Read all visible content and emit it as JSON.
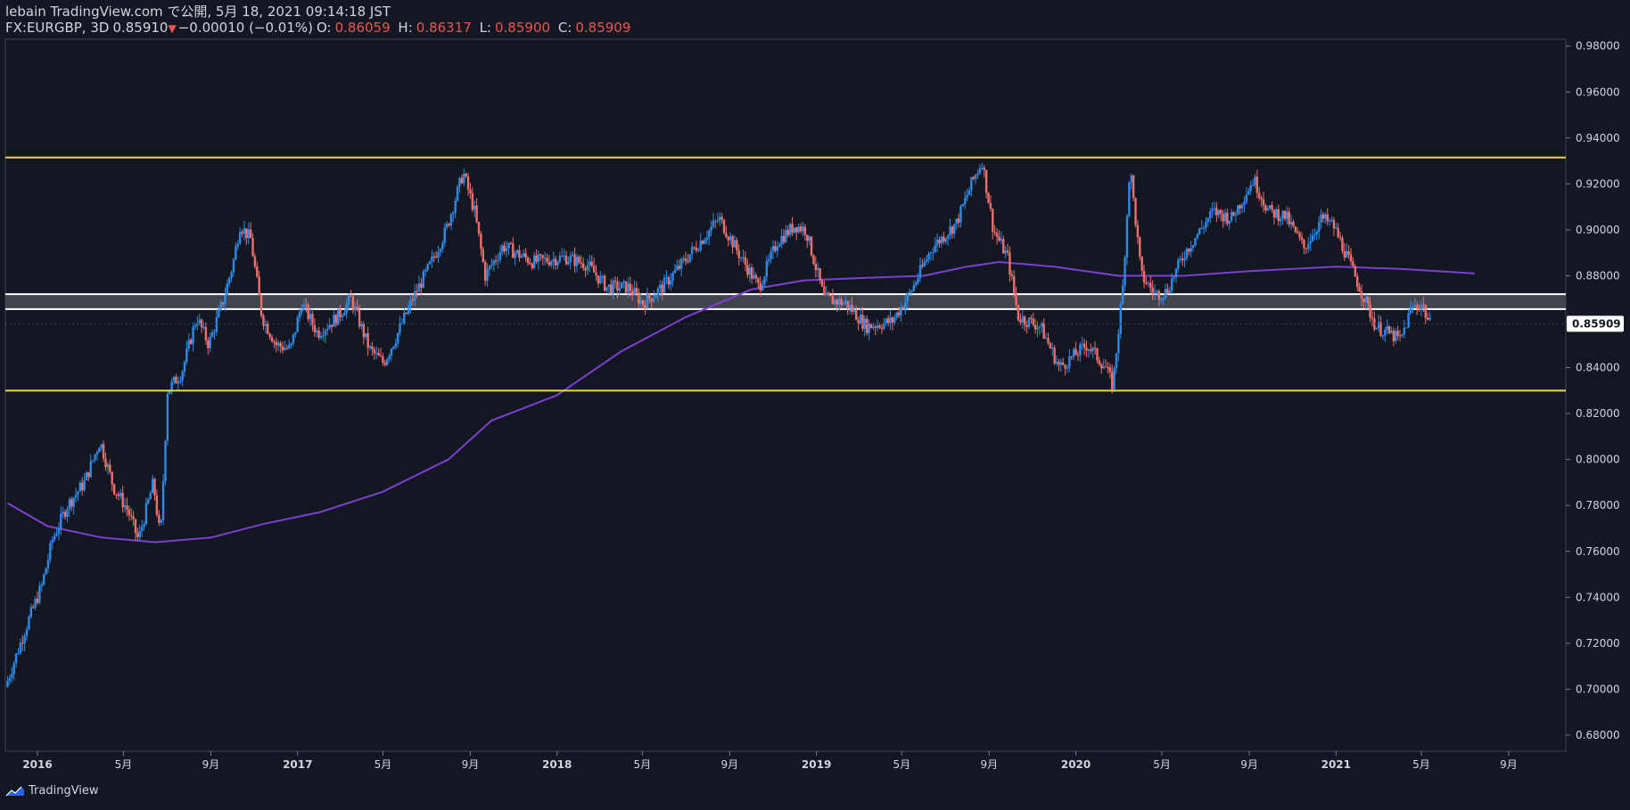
{
  "header": {
    "publisher_line": "lebain TradingView.com で公開, 5月 18, 2021 09:14:18 JST",
    "symbol": "FX:EURGBP, 3D",
    "last": "0.85910",
    "arrow": "▼",
    "change": "−0.00010 (−0.01%)",
    "open_label": "O:",
    "open": "0.86059",
    "high_label": "H:",
    "high": "0.86317",
    "low_label": "L:",
    "low": "0.85900",
    "close_label": "C:",
    "close": "0.85909"
  },
  "footer": {
    "brand": "TradingView"
  },
  "colors": {
    "background": "#131722",
    "up": "#2f8ae6",
    "down": "#ef6f6c",
    "ma": "#7e3fd1",
    "support_resistance": "#f0d44c",
    "zone_fill": "#4a4c54",
    "zone_line": "#ffffff",
    "price_badge": "#ffffff"
  },
  "chart_data": {
    "type": "candlestick",
    "symbol": "FX:EURGBP",
    "timeframe": "3D",
    "y_ticks": [
      "0.98000",
      "0.96000",
      "0.94000",
      "0.92000",
      "0.90000",
      "0.88000",
      "0.86000",
      "0.84000",
      "0.82000",
      "0.80000",
      "0.78000",
      "0.76000",
      "0.74000",
      "0.72000",
      "0.70000",
      "0.68000"
    ],
    "y_range": [
      0.673,
      0.983
    ],
    "current_price_label": "0.85909",
    "current_price": 0.85909,
    "x_ticks": [
      {
        "label": "2016",
        "date": "2016-01"
      },
      {
        "label": "5月",
        "date": "2016-05"
      },
      {
        "label": "9月",
        "date": "2016-09"
      },
      {
        "label": "2017",
        "date": "2017-01"
      },
      {
        "label": "5月",
        "date": "2017-05"
      },
      {
        "label": "9月",
        "date": "2017-09"
      },
      {
        "label": "2018",
        "date": "2018-01"
      },
      {
        "label": "5月",
        "date": "2018-05"
      },
      {
        "label": "9月",
        "date": "2018-09"
      },
      {
        "label": "2019",
        "date": "2019-01"
      },
      {
        "label": "5月",
        "date": "2019-05"
      },
      {
        "label": "9月",
        "date": "2019-09"
      },
      {
        "label": "2020",
        "date": "2020-01"
      },
      {
        "label": "5月",
        "date": "2020-05"
      },
      {
        "label": "9月",
        "date": "2020-09"
      },
      {
        "label": "2021",
        "date": "2021-01"
      },
      {
        "label": "5月",
        "date": "2021-05"
      },
      {
        "label": "9月",
        "date": "2021-09"
      }
    ],
    "horizontal_levels": [
      {
        "name": "resistance",
        "value": 0.9315
      },
      {
        "name": "support",
        "value": 0.83
      }
    ],
    "zone": {
      "top": 0.872,
      "bottom": 0.8655
    },
    "price_path": [
      [
        "2015-11-20",
        0.701
      ],
      [
        "2015-12-20",
        0.728
      ],
      [
        "2016-01-10",
        0.745
      ],
      [
        "2016-01-25",
        0.765
      ],
      [
        "2016-02-15",
        0.78
      ],
      [
        "2016-03-10",
        0.79
      ],
      [
        "2016-04-01",
        0.808
      ],
      [
        "2016-04-20",
        0.788
      ],
      [
        "2016-05-10",
        0.778
      ],
      [
        "2016-05-25",
        0.765
      ],
      [
        "2016-06-15",
        0.79
      ],
      [
        "2016-06-25",
        0.765
      ],
      [
        "2016-07-05",
        0.83
      ],
      [
        "2016-07-25",
        0.838
      ],
      [
        "2016-08-15",
        0.862
      ],
      [
        "2016-09-01",
        0.85
      ],
      [
        "2016-09-20",
        0.868
      ],
      [
        "2016-10-05",
        0.885
      ],
      [
        "2016-10-15",
        0.902
      ],
      [
        "2016-10-30",
        0.896
      ],
      [
        "2016-11-15",
        0.862
      ],
      [
        "2016-12-05",
        0.85
      ],
      [
        "2016-12-25",
        0.848
      ],
      [
        "2017-01-10",
        0.868
      ],
      [
        "2017-02-01",
        0.855
      ],
      [
        "2017-03-01",
        0.862
      ],
      [
        "2017-03-20",
        0.87
      ],
      [
        "2017-04-15",
        0.848
      ],
      [
        "2017-05-05",
        0.842
      ],
      [
        "2017-05-25",
        0.855
      ],
      [
        "2017-06-15",
        0.87
      ],
      [
        "2017-07-10",
        0.885
      ],
      [
        "2017-08-01",
        0.9
      ],
      [
        "2017-08-25",
        0.925
      ],
      [
        "2017-09-10",
        0.908
      ],
      [
        "2017-09-25",
        0.88
      ],
      [
        "2017-10-20",
        0.893
      ],
      [
        "2017-12-01",
        0.886
      ],
      [
        "2018-01-15",
        0.888
      ],
      [
        "2018-02-15",
        0.885
      ],
      [
        "2018-03-15",
        0.875
      ],
      [
        "2018-04-15",
        0.875
      ],
      [
        "2018-05-05",
        0.868
      ],
      [
        "2018-06-01",
        0.875
      ],
      [
        "2018-07-01",
        0.886
      ],
      [
        "2018-08-20",
        0.905
      ],
      [
        "2018-09-20",
        0.888
      ],
      [
        "2018-10-15",
        0.875
      ],
      [
        "2018-11-10",
        0.895
      ],
      [
        "2018-12-05",
        0.902
      ],
      [
        "2018-12-20",
        0.9
      ],
      [
        "2019-01-15",
        0.87
      ],
      [
        "2019-02-15",
        0.868
      ],
      [
        "2019-03-15",
        0.858
      ],
      [
        "2019-04-20",
        0.86
      ],
      [
        "2019-05-15",
        0.872
      ],
      [
        "2019-06-15",
        0.892
      ],
      [
        "2019-07-20",
        0.903
      ],
      [
        "2019-08-10",
        0.92
      ],
      [
        "2019-08-25",
        0.93
      ],
      [
        "2019-09-10",
        0.9
      ],
      [
        "2019-09-30",
        0.888
      ],
      [
        "2019-10-15",
        0.862
      ],
      [
        "2019-11-15",
        0.858
      ],
      [
        "2019-12-12",
        0.84
      ],
      [
        "2020-01-20",
        0.85
      ],
      [
        "2020-02-15",
        0.84
      ],
      [
        "2020-02-25",
        0.832
      ],
      [
        "2020-03-10",
        0.875
      ],
      [
        "2020-03-20",
        0.928
      ],
      [
        "2020-04-05",
        0.88
      ],
      [
        "2020-04-25",
        0.872
      ],
      [
        "2020-05-10",
        0.873
      ],
      [
        "2020-06-05",
        0.89
      ],
      [
        "2020-07-15",
        0.908
      ],
      [
        "2020-08-10",
        0.905
      ],
      [
        "2020-09-10",
        0.922
      ],
      [
        "2020-10-01",
        0.908
      ],
      [
        "2020-10-25",
        0.906
      ],
      [
        "2020-11-20",
        0.892
      ],
      [
        "2020-12-15",
        0.905
      ],
      [
        "2020-12-31",
        0.902
      ],
      [
        "2021-01-20",
        0.888
      ],
      [
        "2021-02-10",
        0.872
      ],
      [
        "2021-03-01",
        0.858
      ],
      [
        "2021-04-05",
        0.852
      ],
      [
        "2021-04-20",
        0.866
      ],
      [
        "2021-05-05",
        0.868
      ],
      [
        "2021-05-15",
        0.859
      ]
    ],
    "moving_average": [
      [
        "2015-11-20",
        0.781
      ],
      [
        "2016-01-15",
        0.771
      ],
      [
        "2016-04-01",
        0.766
      ],
      [
        "2016-06-15",
        0.764
      ],
      [
        "2016-09-01",
        0.766
      ],
      [
        "2016-11-15",
        0.772
      ],
      [
        "2017-02-01",
        0.777
      ],
      [
        "2017-05-01",
        0.786
      ],
      [
        "2017-08-01",
        0.8
      ],
      [
        "2017-10-01",
        0.817
      ],
      [
        "2018-01-01",
        0.828
      ],
      [
        "2018-04-01",
        0.847
      ],
      [
        "2018-07-01",
        0.862
      ],
      [
        "2018-10-01",
        0.874
      ],
      [
        "2018-12-15",
        0.878
      ],
      [
        "2019-03-01",
        0.879
      ],
      [
        "2019-06-01",
        0.88
      ],
      [
        "2019-08-01",
        0.884
      ],
      [
        "2019-09-15",
        0.886
      ],
      [
        "2019-12-01",
        0.884
      ],
      [
        "2020-03-01",
        0.88
      ],
      [
        "2020-06-01",
        0.88
      ],
      [
        "2020-09-01",
        0.882
      ],
      [
        "2021-01-01",
        0.884
      ],
      [
        "2021-04-01",
        0.883
      ],
      [
        "2021-07-15",
        0.881
      ]
    ]
  }
}
